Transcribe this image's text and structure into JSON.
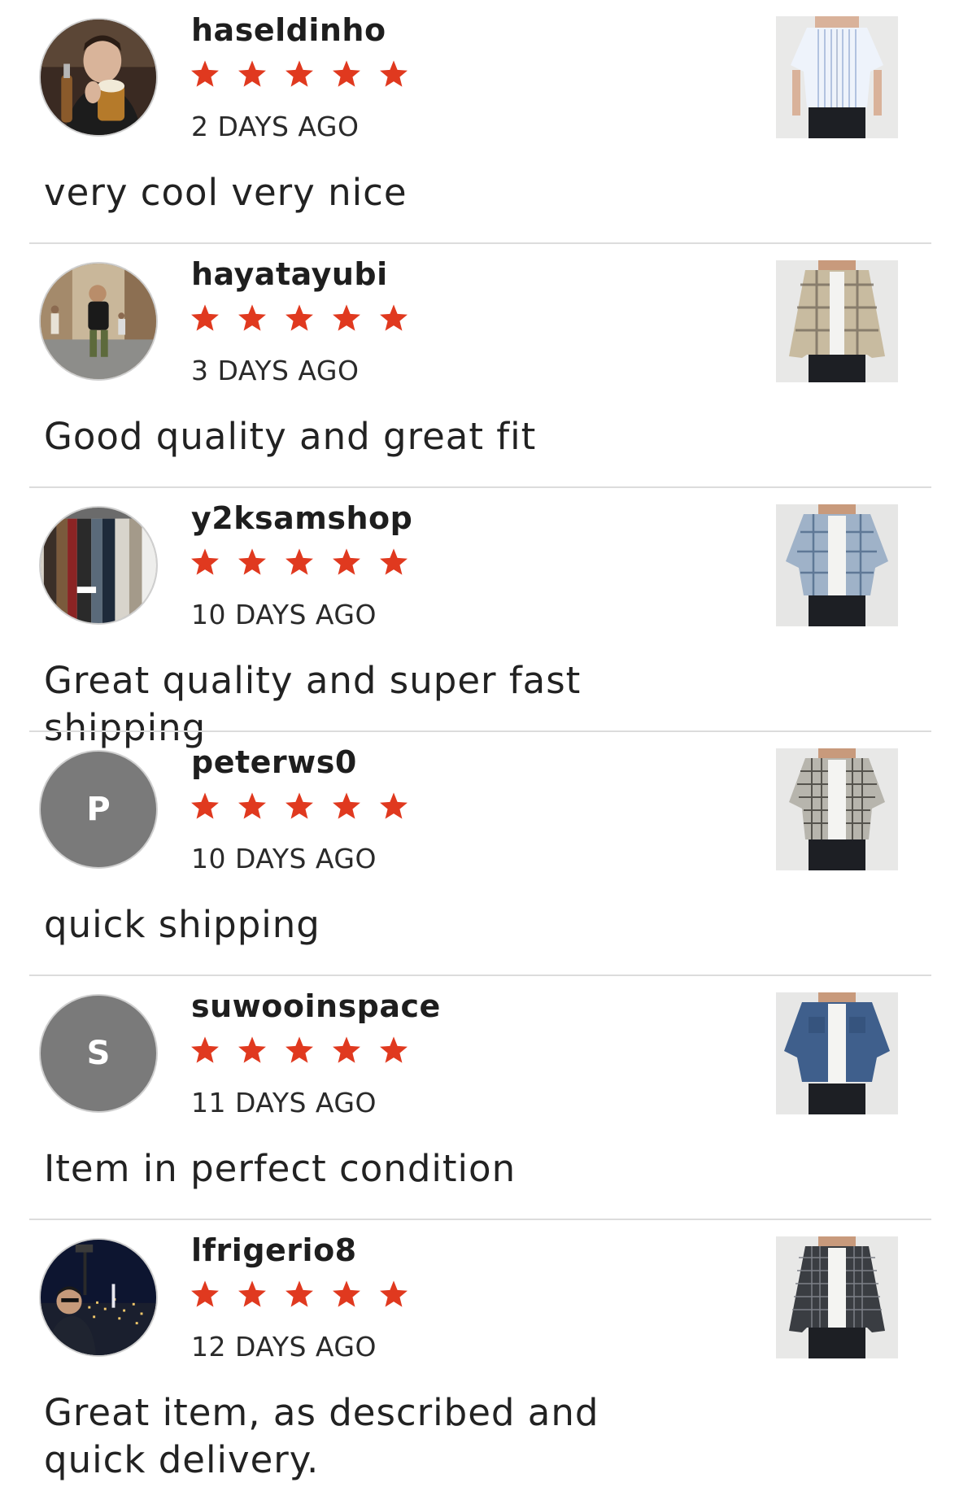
{
  "colors": {
    "star": "#e0391f",
    "divider": "#dcdcdc",
    "initial_avatar": "#7a7a7a"
  },
  "reviews": [
    {
      "username": "haseldinho",
      "rating": 5,
      "date": "2 DAYS AGO",
      "text": "very cool very nice",
      "avatar": "photo-man-with-beer",
      "thumbnail": "white-striped-short-sleeve-shirt"
    },
    {
      "username": "hayatayubi",
      "rating": 5,
      "date": "3 DAYS AGO",
      "text": "Good quality and great fit",
      "avatar": "photo-person-in-street",
      "thumbnail": "beige-plaid-flannel-shirt"
    },
    {
      "username": "y2ksamshop",
      "rating": 5,
      "date": "10 DAYS AGO",
      "text": "Great quality and super fast shipping",
      "avatar": "photo-clothing-rack",
      "thumbnail": "blue-plaid-short-sleeve-shirt"
    },
    {
      "username": "peterws0",
      "rating": 5,
      "date": "10 DAYS AGO",
      "text": "quick shipping",
      "avatar_initial": "P",
      "thumbnail": "grey-check-short-sleeve-shirt"
    },
    {
      "username": "suwooinspace",
      "rating": 5,
      "date": "11 DAYS AGO",
      "text": "Item in perfect condition",
      "avatar_initial": "S",
      "thumbnail": "blue-denim-short-sleeve-shirt"
    },
    {
      "username": "lfrigerio8",
      "rating": 5,
      "date": "12 DAYS AGO",
      "text": "Great item, as described and quick delivery.",
      "avatar": "photo-night-city-selfie",
      "thumbnail": "black-check-long-sleeve-shirt"
    }
  ]
}
